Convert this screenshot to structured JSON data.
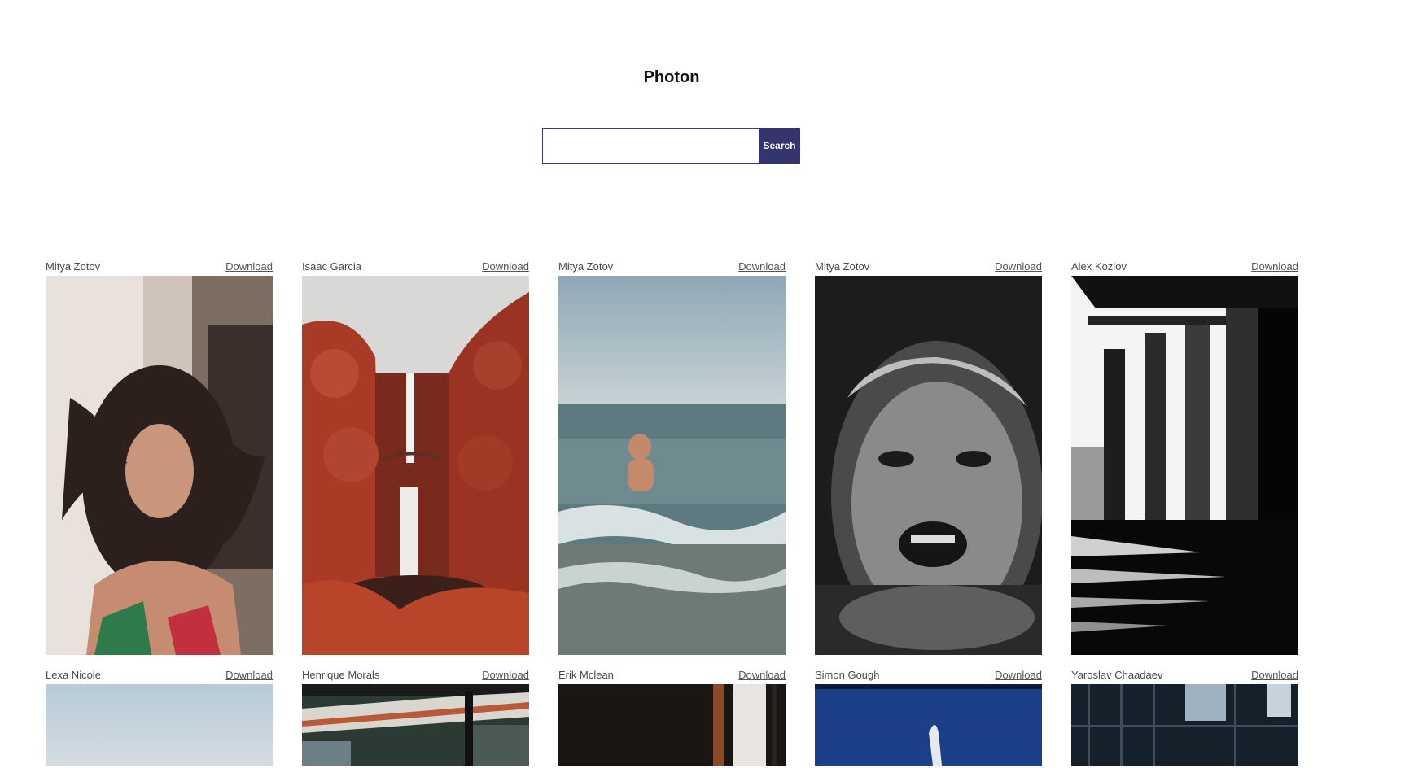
{
  "app": {
    "title": "Photon"
  },
  "search": {
    "value": "",
    "placeholder": "",
    "button_label": "Search"
  },
  "photos": [
    {
      "author": "Mitya Zotov",
      "download_label": "Download"
    },
    {
      "author": "Isaac Garcia",
      "download_label": "Download"
    },
    {
      "author": "Mitya Zotov",
      "download_label": "Download"
    },
    {
      "author": "Mitya Zotov",
      "download_label": "Download"
    },
    {
      "author": "Alex Kozlov",
      "download_label": "Download"
    },
    {
      "author": "Lexa Nicole",
      "download_label": "Download"
    },
    {
      "author": "Henrique Morals",
      "download_label": "Download"
    },
    {
      "author": "Erik Mclean",
      "download_label": "Download"
    },
    {
      "author": "Simon Gough",
      "download_label": "Download"
    },
    {
      "author": "Yaroslav Chaadaev",
      "download_label": "Download"
    }
  ],
  "colors": {
    "accent": "#34346f",
    "background": "#ffffff"
  }
}
